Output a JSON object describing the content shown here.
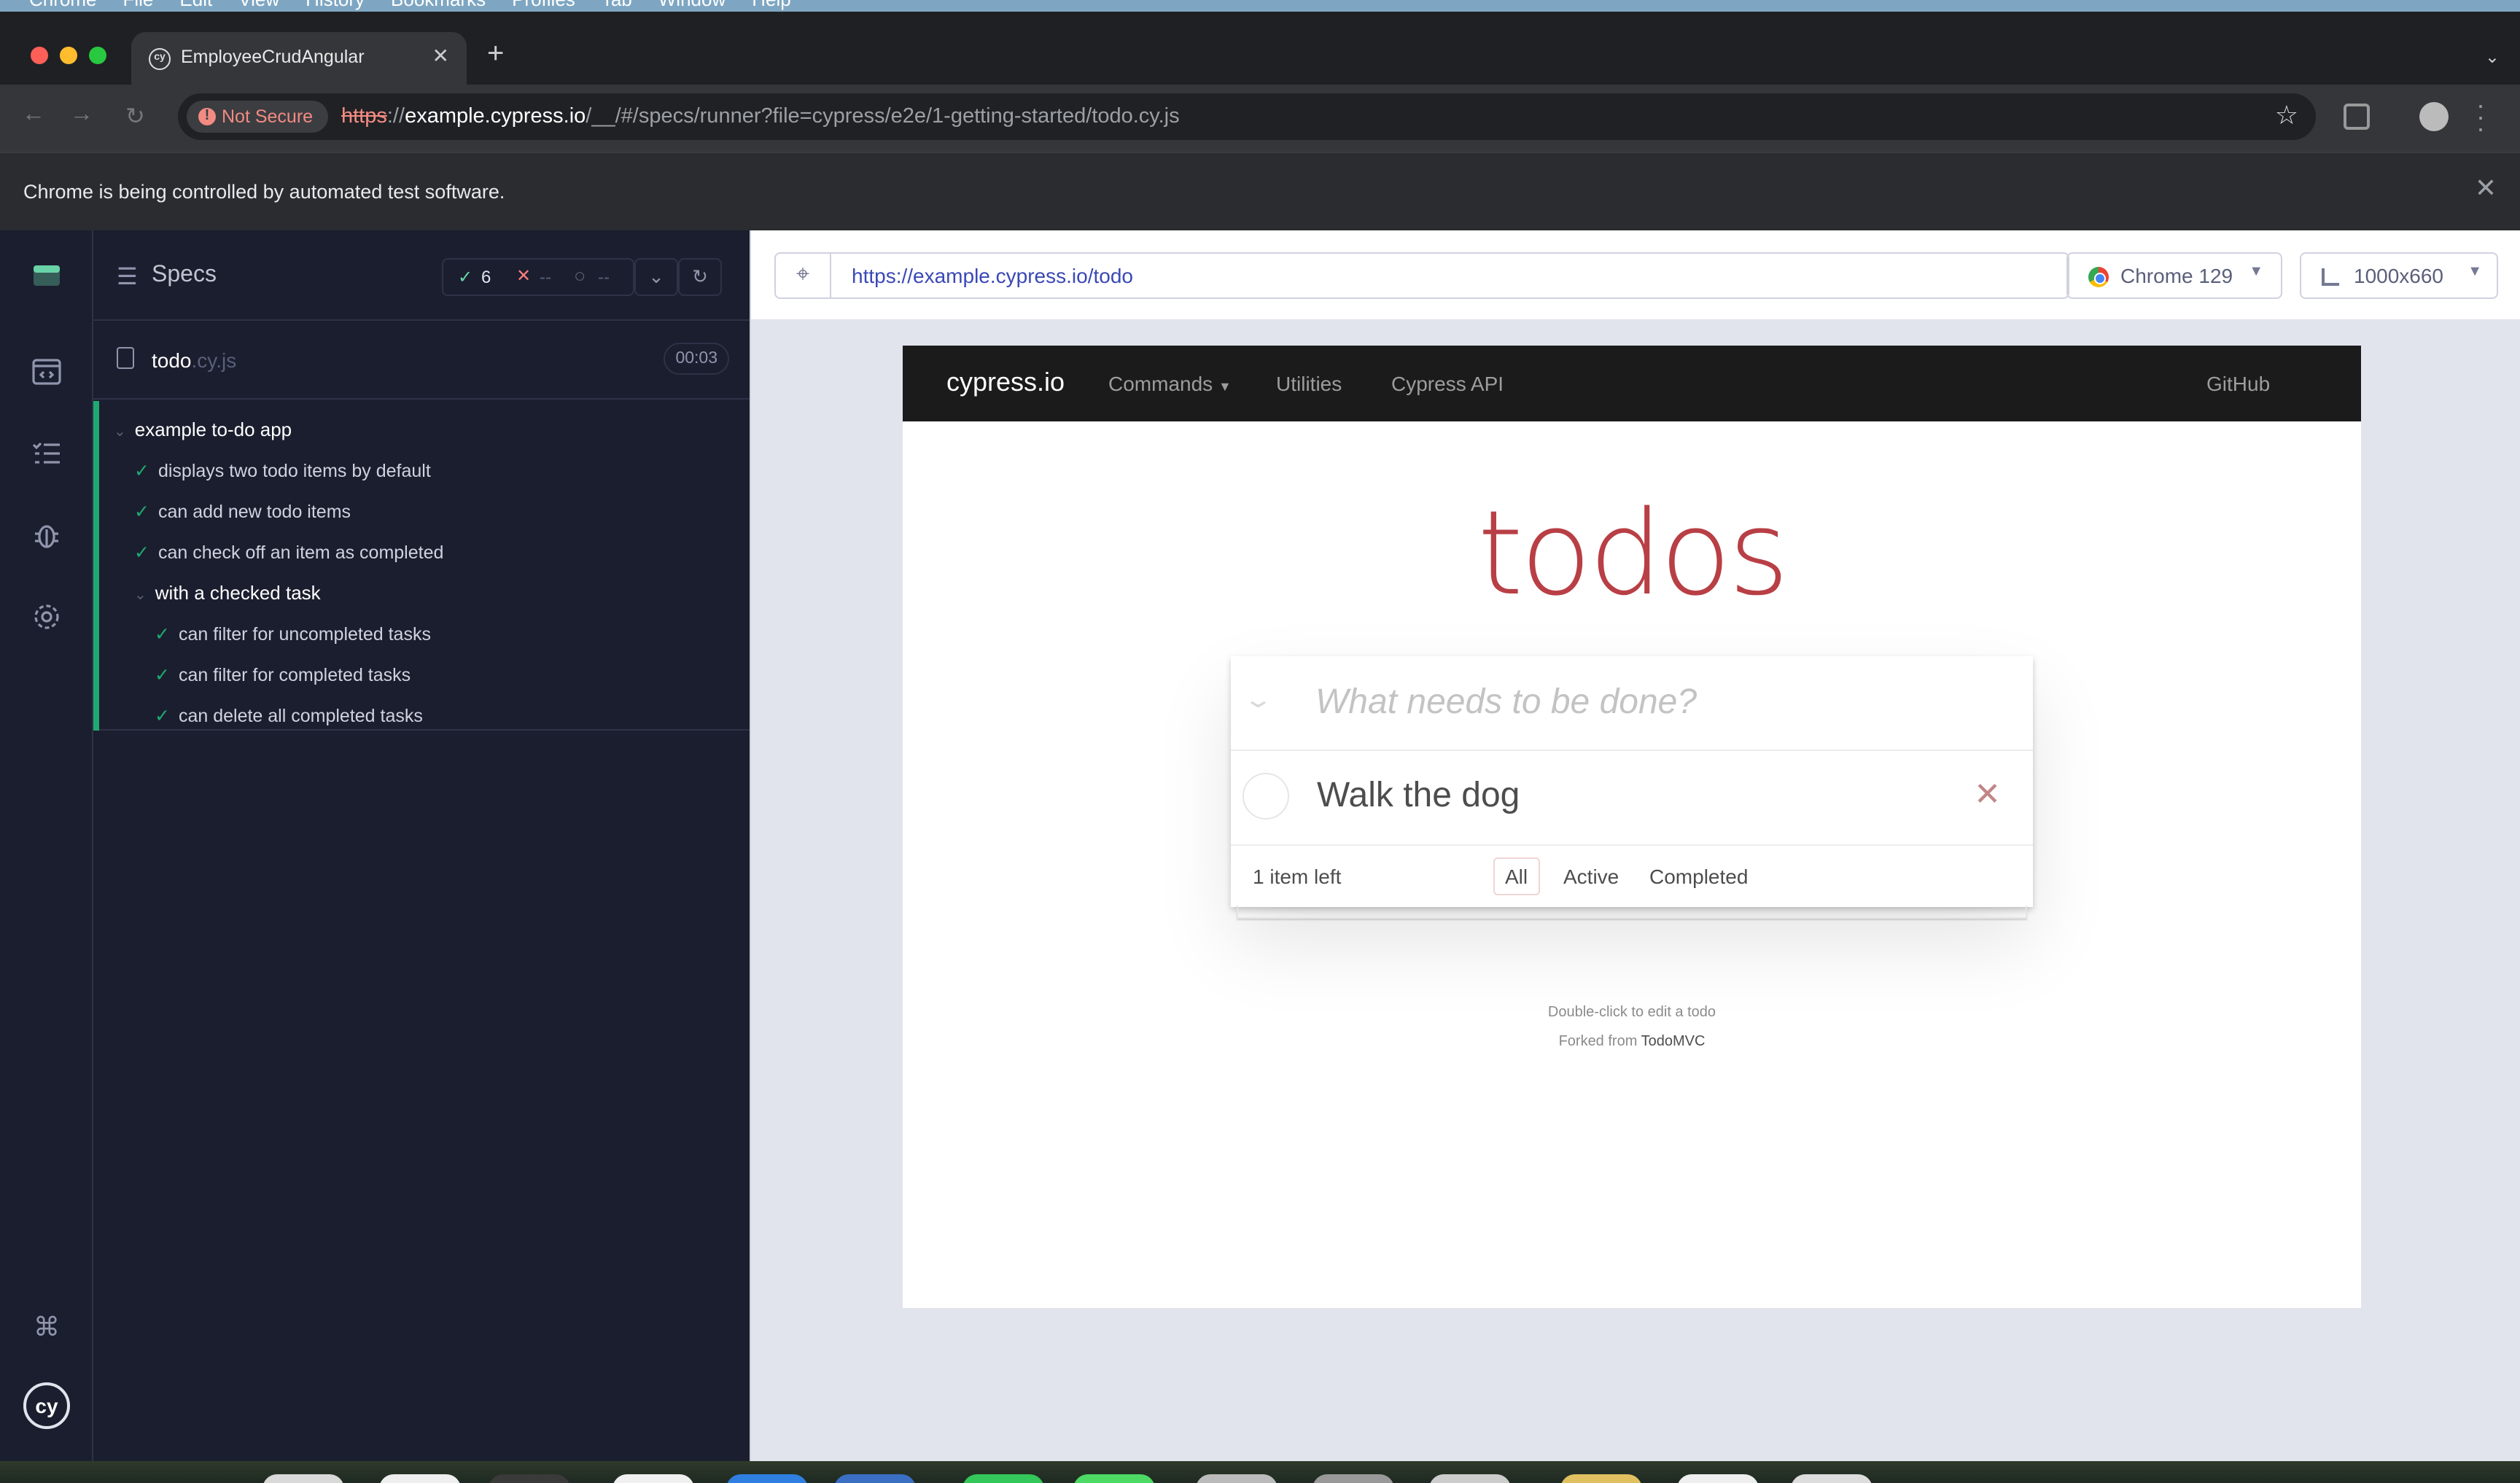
{
  "browser": {
    "tab_title": "EmployeeCrudAngular",
    "not_secure": "Not Secure",
    "url_scheme": "https",
    "url_sep": "://",
    "url_host": "example.cypress.io",
    "url_path": "/__/#/specs/runner?file=cypress/e2e/1-getting-started/todo.cy.js",
    "infobar": "Chrome is being controlled by automated test software."
  },
  "reporter": {
    "title": "Specs",
    "passed": "6",
    "failed": "--",
    "pending": "--",
    "spec_name": "todo",
    "spec_ext": ".cy.js",
    "duration": "00:03",
    "suite": "example to-do app",
    "tests": [
      "displays two todo items by default",
      "can add new todo items",
      "can check off an item as completed"
    ],
    "subsuite": "with a checked task",
    "subtests": [
      "can filter for uncompleted tasks",
      "can filter for completed tasks",
      "can delete all completed tasks"
    ]
  },
  "aut": {
    "url": "https://example.cypress.io/todo",
    "browser": "Chrome 129",
    "viewport": "1000x660"
  },
  "page": {
    "brand": "cypress.io",
    "nav": [
      "Commands",
      "Utilities",
      "Cypress API"
    ],
    "github": "GitHub",
    "heading": "todos",
    "placeholder": "What needs to be done?",
    "todo_item": "Walk the dog",
    "count": "1 item left",
    "filters": [
      "All",
      "Active",
      "Completed"
    ],
    "info_edit": "Double-click to edit a todo",
    "info_forked": "Forked from",
    "info_link": "TodoMVC"
  },
  "colors": {
    "accent_pass": "#1fa971",
    "todos_red": "#b83f45"
  }
}
